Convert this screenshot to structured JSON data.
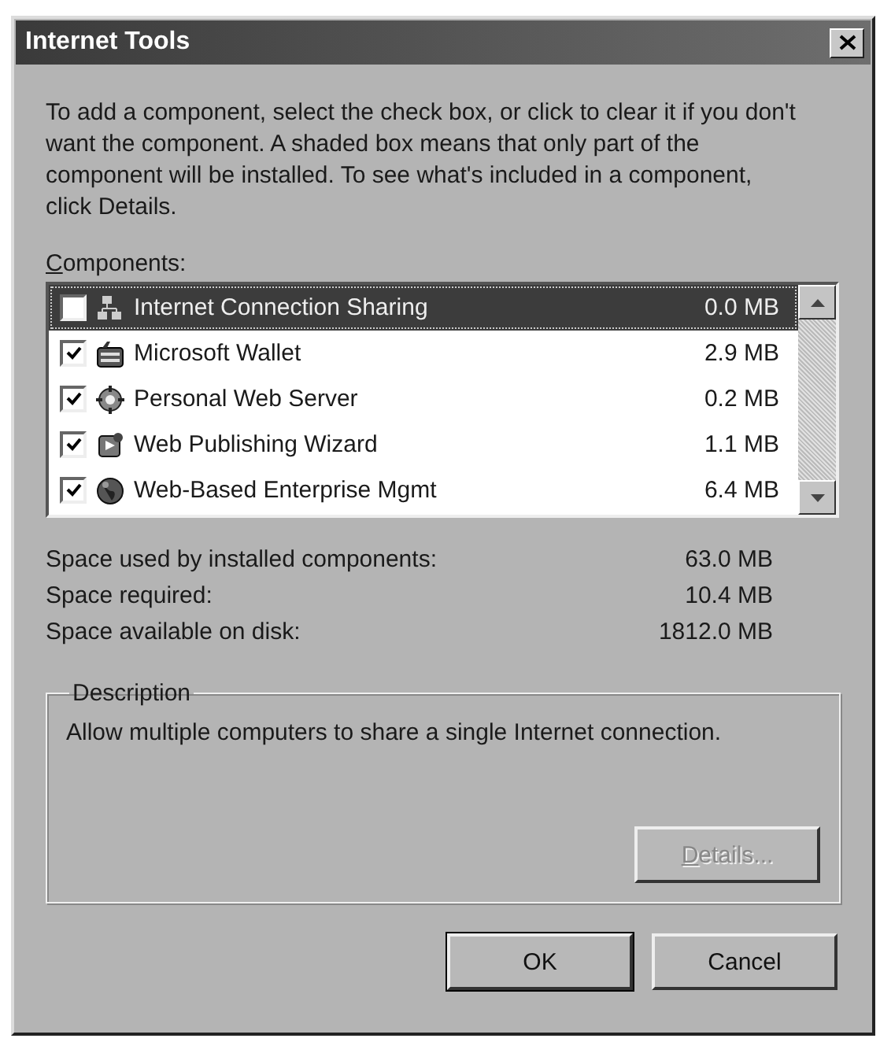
{
  "window": {
    "title": "Internet Tools"
  },
  "instructions": "To add a component, select the check box, or click to clear it if you don't want the component. A shaded box means that only part of the component will be installed. To see what's included in a component, click Details.",
  "components_label": "Components:",
  "components": [
    {
      "name": "Internet Connection Sharing",
      "size": "0.0 MB",
      "checked": false,
      "selected": true
    },
    {
      "name": "Microsoft Wallet",
      "size": "2.9 MB",
      "checked": true,
      "selected": false
    },
    {
      "name": "Personal Web Server",
      "size": "0.2 MB",
      "checked": true,
      "selected": false
    },
    {
      "name": "Web Publishing Wizard",
      "size": "1.1 MB",
      "checked": true,
      "selected": false
    },
    {
      "name": "Web-Based Enterprise Mgmt",
      "size": "6.4 MB",
      "checked": true,
      "selected": false
    }
  ],
  "space": [
    {
      "label": "Space used by installed components:",
      "value": "63.0 MB"
    },
    {
      "label": "Space required:",
      "value": "10.4 MB"
    },
    {
      "label": "Space available on disk:",
      "value": "1812.0 MB"
    }
  ],
  "description": {
    "title": "Description",
    "text": "Allow multiple computers to share a single Internet connection."
  },
  "buttons": [
    {
      "kind": "details",
      "label": "Details...",
      "disabled": true
    },
    {
      "kind": "ok",
      "label": "OK",
      "disabled": false
    },
    {
      "kind": "cancel",
      "label": "Cancel",
      "disabled": false
    }
  ]
}
